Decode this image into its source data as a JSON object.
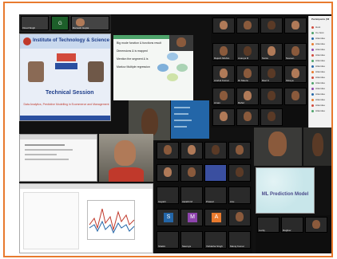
{
  "poster": {
    "institute": "Institute of Technology & Science",
    "session": "Technical Session",
    "topic": "Data Analytics, Predictive Modelling in Ecommerce and Management"
  },
  "slide": {
    "bullets": [
      "Big mode function & functions result",
      "Dimensions & is mapped",
      "Mention the segment & is",
      "Markov Multiple regression"
    ]
  },
  "presentation": {
    "title": "ML Prediction Model"
  },
  "top_tiles": [
    {
      "label": "Vinod Singh"
    },
    {
      "label": "G"
    },
    {
      "label": "Ramesh Gupta"
    },
    {
      "label": "Anil Kumar"
    },
    {
      "label": "Priya"
    }
  ],
  "grid_labels": [
    "Rajesh Mishra",
    "Ananya R",
    "Sonia",
    "Naveen",
    "Anshul Kumar",
    "Dr Meera",
    "Ravi K",
    "Shreya",
    "Aman",
    "Rahul"
  ],
  "bottom_labels": [
    "Gayatri",
    "Aarathi M",
    "Prasad",
    "Anu",
    "Shalini",
    "Saumya",
    "Vishakha Singh",
    "Manoj Kumar",
    "Lucky",
    "Raghav"
  ],
  "avatar_letters": [
    "S",
    "M",
    "A"
  ],
  "chat_items": [
    "Participants (58)",
    "Host",
    "Co-host",
    "Attendee",
    "Attendee",
    "Attendee",
    "Attendee",
    "Attendee",
    "Attendee",
    "Attendee",
    "Attendee",
    "Attendee",
    "Attendee",
    "Attendee",
    "Attendee",
    "Attendee",
    "Attendee"
  ],
  "colors": {
    "frame": "#e87a2e",
    "poster_bg": "#e9eef7",
    "slide_accent": "#2f6db3",
    "pres_bg": "#c8e6ea",
    "pres_title": "#4a4a8a"
  }
}
